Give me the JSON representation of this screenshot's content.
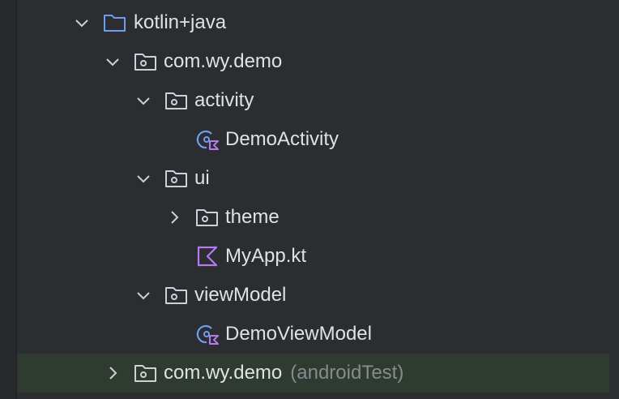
{
  "tree": {
    "items": [
      {
        "label": "kotlin+java",
        "suffix": ""
      },
      {
        "label": "com.wy.demo",
        "suffix": ""
      },
      {
        "label": "activity",
        "suffix": ""
      },
      {
        "label": "DemoActivity",
        "suffix": ""
      },
      {
        "label": "ui",
        "suffix": ""
      },
      {
        "label": "theme",
        "suffix": ""
      },
      {
        "label": "MyApp.kt",
        "suffix": ""
      },
      {
        "label": "viewModel",
        "suffix": ""
      },
      {
        "label": "DemoViewModel",
        "suffix": ""
      },
      {
        "label": "com.wy.demo",
        "suffix": "(androidTest)"
      }
    ],
    "selected_index": 9
  },
  "colors": {
    "background": "#2b2d30",
    "text": "#dfe1e5",
    "muted": "#868a91",
    "folder_blue": "#6f9cf0",
    "kotlin_purple": "#b07cf0",
    "selection": "#2f3b30"
  },
  "icons": {
    "source_root": "folder-icon",
    "package": "package-folder-icon",
    "kotlin_class": "kotlin-class-icon",
    "kotlin_file": "kotlin-file-icon",
    "expanded": "chevron-down-icon",
    "collapsed": "chevron-right-icon"
  }
}
